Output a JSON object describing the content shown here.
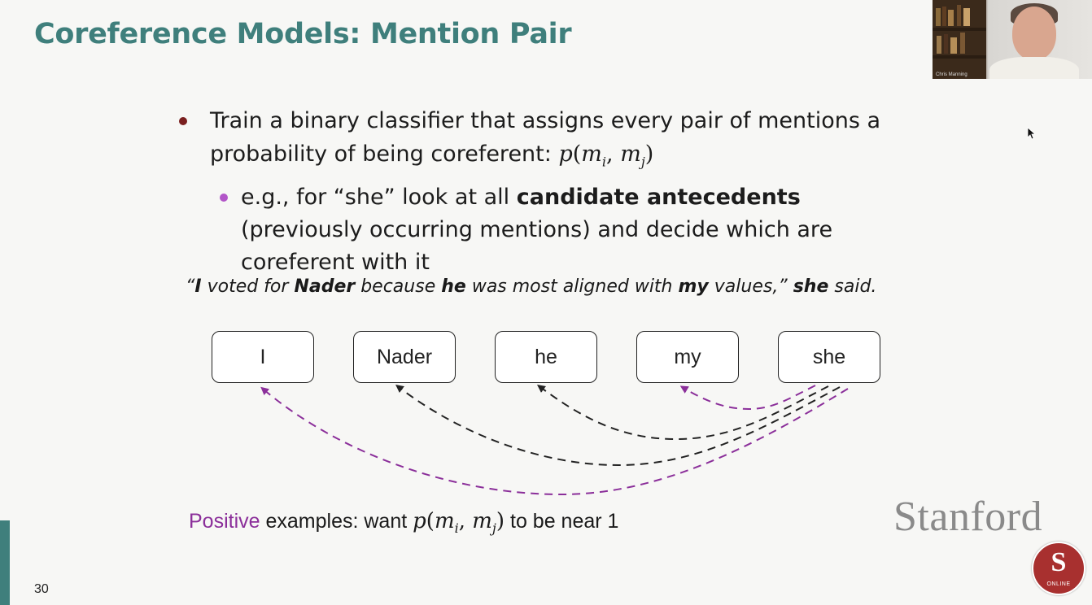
{
  "slide": {
    "title": "Coreference Models: Mention Pair",
    "bullet1": "Train a binary classifier that assigns every pair of mentions a probability of being coreferent:",
    "math": {
      "p": "p",
      "m": "m",
      "i": "i",
      "j": "j",
      "open": "(",
      "comma": ",",
      "close": ")"
    },
    "bullet2_pre": "e.g., for “she” look at all",
    "bullet2_bold": "candidate antecedents",
    "bullet2_post": "(previously occurring mentions) and decide which are coreferent with it",
    "quote": {
      "open": "“",
      "w1": "I",
      "t1": " voted for ",
      "w2": "Nader",
      "t2": " because ",
      "w3": "he",
      "t3": " was most aligned with ",
      "w4": "my",
      "t4": " values,” ",
      "w5": "she",
      "t5": " said."
    },
    "mentions": [
      "I",
      "Nader",
      "he",
      "my",
      "she"
    ],
    "positive_word": "Positive",
    "positive_mid": " examples: want ",
    "positive_end": " to be near 1",
    "wordmark": "Stanford",
    "seal_letter": "S",
    "seal_text": "ONLINE",
    "page_number": "30",
    "webcam_caption": "Chris Manning"
  },
  "colors": {
    "title": "#3f7f7c",
    "positive": "#8b2f9a",
    "arrow_positive": "#8b2f9a",
    "arrow_other": "#222222",
    "bullet1_dot": "#7a1f1f",
    "bullet2_dot": "#b255c8"
  }
}
